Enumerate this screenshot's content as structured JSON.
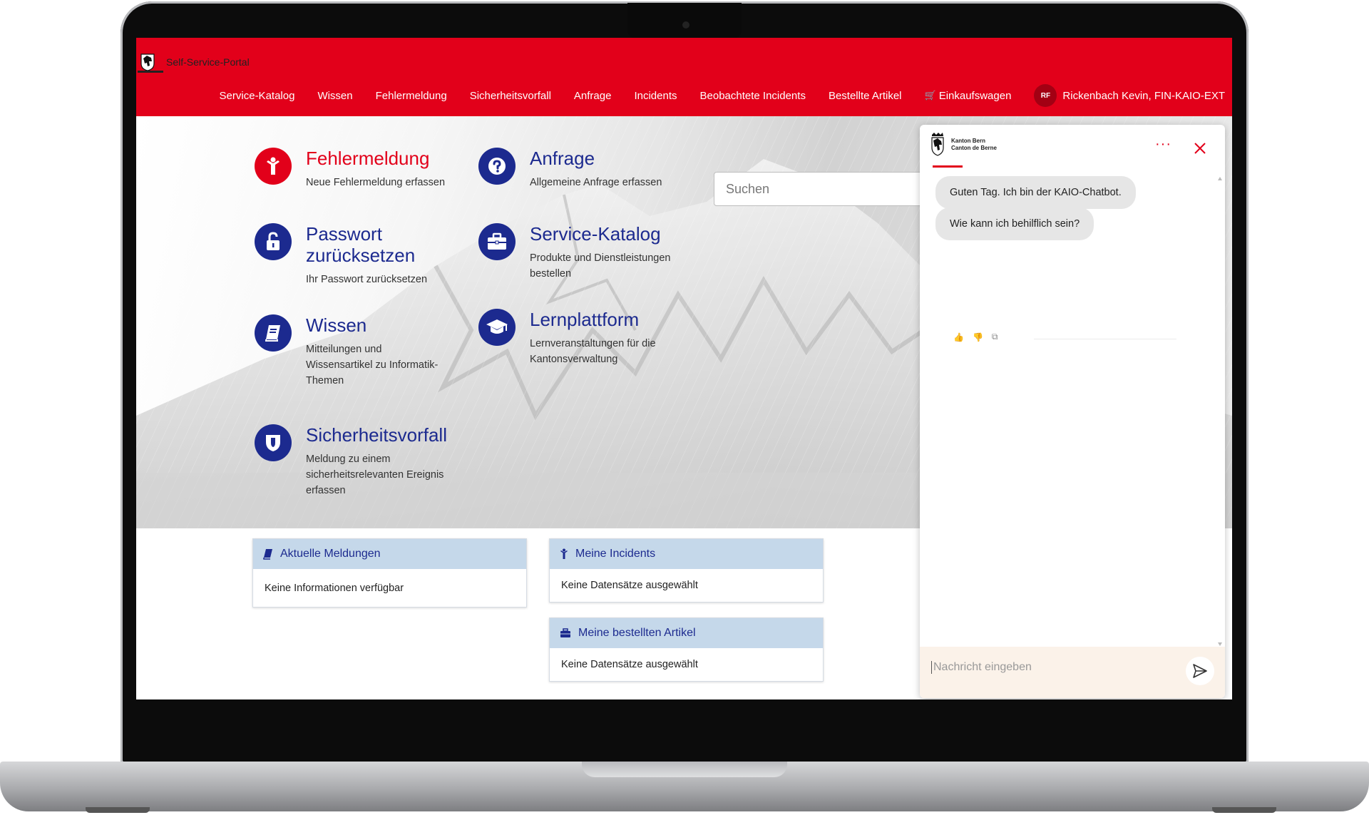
{
  "header": {
    "brand_title": "Self-Service-Portal",
    "nav": [
      "Service-Katalog",
      "Wissen",
      "Fehlermeldung",
      "Sicherheitsvorfall",
      "Anfrage",
      "Incidents",
      "Beobachtete Incidents",
      "Bestellte Artikel"
    ],
    "cart_label": "Einkaufswagen",
    "user_initials": "RF",
    "user_name": "Rickenbach Kevin, FIN-KAIO-EXT"
  },
  "tiles": {
    "fehlermeldung": {
      "title": "Fehlermeldung",
      "desc": "Neue Fehlermeldung erfassen"
    },
    "anfrage": {
      "title": "Anfrage",
      "desc": "Allgemeine Anfrage erfassen"
    },
    "passwort": {
      "title_line1": "Passwort",
      "title_line2": "zurücksetzen",
      "desc": "Ihr Passwort zurücksetzen"
    },
    "service_katalog": {
      "title": "Service-Katalog",
      "desc_line1": "Produkte und Dienstleistungen",
      "desc_line2": "bestellen"
    },
    "wissen": {
      "title": "Wissen",
      "desc_line1": "Mitteilungen und",
      "desc_line2": "Wissensartikel zu Informatik-",
      "desc_line3": "Themen"
    },
    "lernplattform": {
      "title": "Lernplattform",
      "desc_line1": "Lernveranstaltungen für die",
      "desc_line2": "Kantonsverwaltung"
    },
    "sicherheitsvorfall": {
      "title": "Sicherheitsvorfall",
      "desc_line1": "Meldung zu einem",
      "desc_line2": "sicherheitsrelevanten Ereignis",
      "desc_line3": "erfassen"
    }
  },
  "search": {
    "placeholder": "Suchen"
  },
  "panels": {
    "aktuelle_meldungen": {
      "title": "Aktuelle Meldungen",
      "body": "Keine Informationen verfügbar"
    },
    "meine_incidents": {
      "title": "Meine Incidents",
      "body": "Keine Datensätze ausgewählt"
    },
    "meine_artikel": {
      "title": "Meine bestellten Artikel",
      "body": "Keine Datensätze ausgewählt"
    }
  },
  "chat": {
    "logo_line1": "Kanton Bern",
    "logo_line2": "Canton de Berne",
    "messages": [
      "Guten Tag. Ich bin der KAIO-Chatbot.",
      "Wie kann ich behilflich sein?"
    ],
    "input_placeholder": "Nachricht eingeben"
  },
  "colors": {
    "brand_red": "#e2001a",
    "nav_blue": "#1c2a8f",
    "panel_head": "#c5d8ea",
    "chat_input_bg": "#fbf2e9"
  }
}
